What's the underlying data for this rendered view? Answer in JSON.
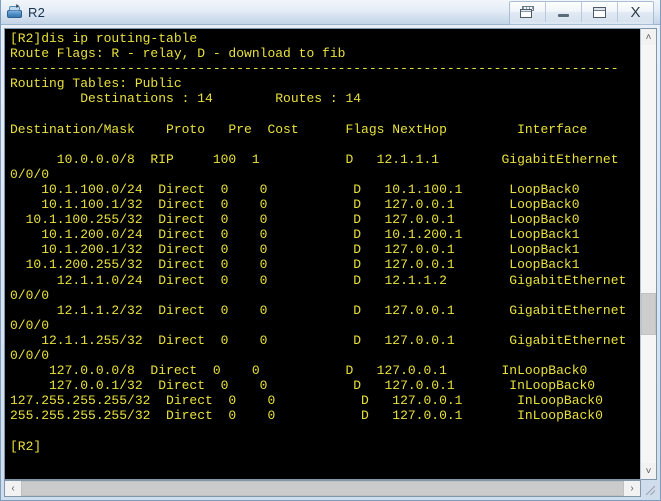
{
  "window": {
    "title": "R2",
    "icon": "router-icon",
    "buttons": [
      {
        "name": "restore-down-button",
        "label": "",
        "glyph": "restore-icon"
      },
      {
        "name": "minimize-button",
        "label": "",
        "glyph": "minimize-icon"
      },
      {
        "name": "maximize-button",
        "label": "",
        "glyph": "maximize-icon"
      },
      {
        "name": "close-button",
        "label": "X",
        "glyph": "close-icon"
      }
    ]
  },
  "console": {
    "foreground_color": "#e8e03c",
    "background_color": "#000000",
    "prompt": "[R2]",
    "command": "dis ip routing-table",
    "lines": [
      "[R2]dis ip routing-table",
      "Route Flags: R - relay, D - download to fib",
      "------------------------------------------------------------------------------",
      "Routing Tables: Public",
      "         Destinations : 14        Routes : 14",
      "",
      "Destination/Mask    Proto   Pre  Cost      Flags NextHop         Interface",
      "",
      "      10.0.0.0/8  RIP     100  1           D   12.1.1.1        GigabitEthernet",
      "0/0/0",
      "    10.1.100.0/24  Direct  0    0           D   10.1.100.1      LoopBack0",
      "    10.1.100.1/32  Direct  0    0           D   127.0.0.1       LoopBack0",
      "  10.1.100.255/32  Direct  0    0           D   127.0.0.1       LoopBack0",
      "    10.1.200.0/24  Direct  0    0           D   10.1.200.1      LoopBack1",
      "    10.1.200.1/32  Direct  0    0           D   127.0.0.1       LoopBack1",
      "  10.1.200.255/32  Direct  0    0           D   127.0.0.1       LoopBack1",
      "      12.1.1.0/24  Direct  0    0           D   12.1.1.2        GigabitEthernet",
      "0/0/0",
      "      12.1.1.2/32  Direct  0    0           D   127.0.0.1       GigabitEthernet",
      "0/0/0",
      "    12.1.1.255/32  Direct  0    0           D   127.0.0.1       GigabitEthernet",
      "0/0/0",
      "     127.0.0.0/8  Direct  0    0           D   127.0.0.1       InLoopBack0",
      "     127.0.0.1/32  Direct  0    0           D   127.0.0.1       InLoopBack0",
      "127.255.255.255/32  Direct  0    0           D   127.0.0.1       InLoopBack0",
      "255.255.255.255/32  Direct  0    0           D   127.0.0.1       InLoopBack0",
      "",
      "[R2]"
    ],
    "route_flags": {
      "R": "relay",
      "D": "download to fib"
    },
    "routing_tables_label": "Routing Tables: Public",
    "destinations_count": "14",
    "routes_count": "14",
    "columns": [
      "Destination/Mask",
      "Proto",
      "Pre",
      "Cost",
      "Flags",
      "NextHop",
      "Interface"
    ],
    "rows": [
      {
        "destination": "10.0.0.0/8",
        "proto": "RIP",
        "pre": "100",
        "cost": "1",
        "flags": "D",
        "nexthop": "12.1.1.1",
        "interface": "GigabitEthernet0/0/0"
      },
      {
        "destination": "10.1.100.0/24",
        "proto": "Direct",
        "pre": "0",
        "cost": "0",
        "flags": "D",
        "nexthop": "10.1.100.1",
        "interface": "LoopBack0"
      },
      {
        "destination": "10.1.100.1/32",
        "proto": "Direct",
        "pre": "0",
        "cost": "0",
        "flags": "D",
        "nexthop": "127.0.0.1",
        "interface": "LoopBack0"
      },
      {
        "destination": "10.1.100.255/32",
        "proto": "Direct",
        "pre": "0",
        "cost": "0",
        "flags": "D",
        "nexthop": "127.0.0.1",
        "interface": "LoopBack0"
      },
      {
        "destination": "10.1.200.0/24",
        "proto": "Direct",
        "pre": "0",
        "cost": "0",
        "flags": "D",
        "nexthop": "10.1.200.1",
        "interface": "LoopBack1"
      },
      {
        "destination": "10.1.200.1/32",
        "proto": "Direct",
        "pre": "0",
        "cost": "0",
        "flags": "D",
        "nexthop": "127.0.0.1",
        "interface": "LoopBack1"
      },
      {
        "destination": "10.1.200.255/32",
        "proto": "Direct",
        "pre": "0",
        "cost": "0",
        "flags": "D",
        "nexthop": "127.0.0.1",
        "interface": "LoopBack1"
      },
      {
        "destination": "12.1.1.0/24",
        "proto": "Direct",
        "pre": "0",
        "cost": "0",
        "flags": "D",
        "nexthop": "12.1.1.2",
        "interface": "GigabitEthernet0/0/0"
      },
      {
        "destination": "12.1.1.2/32",
        "proto": "Direct",
        "pre": "0",
        "cost": "0",
        "flags": "D",
        "nexthop": "127.0.0.1",
        "interface": "GigabitEthernet0/0/0"
      },
      {
        "destination": "12.1.1.255/32",
        "proto": "Direct",
        "pre": "0",
        "cost": "0",
        "flags": "D",
        "nexthop": "127.0.0.1",
        "interface": "GigabitEthernet0/0/0"
      },
      {
        "destination": "127.0.0.0/8",
        "proto": "Direct",
        "pre": "0",
        "cost": "0",
        "flags": "D",
        "nexthop": "127.0.0.1",
        "interface": "InLoopBack0"
      },
      {
        "destination": "127.0.0.1/32",
        "proto": "Direct",
        "pre": "0",
        "cost": "0",
        "flags": "D",
        "nexthop": "127.0.0.1",
        "interface": "InLoopBack0"
      },
      {
        "destination": "127.255.255.255/32",
        "proto": "Direct",
        "pre": "0",
        "cost": "0",
        "flags": "D",
        "nexthop": "127.0.0.1",
        "interface": "InLoopBack0"
      },
      {
        "destination": "255.255.255.255/32",
        "proto": "Direct",
        "pre": "0",
        "cost": "0",
        "flags": "D",
        "nexthop": "127.0.0.1",
        "interface": "InLoopBack0"
      }
    ]
  },
  "scrollbars": {
    "vertical": {
      "up_arrow": "˄",
      "down_arrow": "˅"
    },
    "horizontal": {
      "left_arrow": "‹",
      "right_arrow": "›"
    }
  }
}
